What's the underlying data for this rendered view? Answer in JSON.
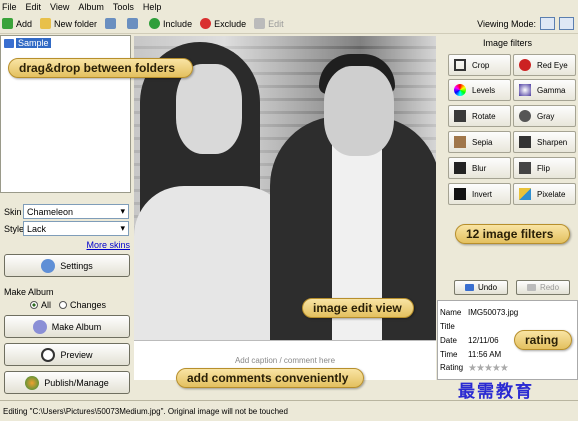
{
  "menu": [
    "File",
    "Edit",
    "View",
    "Album",
    "Tools",
    "Help"
  ],
  "toolbar": {
    "add": "Add",
    "new_folder": "New folder",
    "include": "Include",
    "exclude": "Exclude",
    "edit": "Edit",
    "viewing_mode_label": "Viewing Mode:"
  },
  "tree": {
    "item": "Sample"
  },
  "left": {
    "skin_label": "Skin",
    "skin_value": "Chameleon",
    "style_label": "Style",
    "style_value": "Lack",
    "more_skins": "More skins",
    "settings": "Settings",
    "make_album_group": "Make Album",
    "radio_all": "All",
    "radio_changes": "Changes",
    "make_album_btn": "Make Album",
    "preview": "Preview",
    "publish": "Publish/Manage"
  },
  "filters": {
    "title": "Image filters",
    "items": [
      "Crop",
      "Red Eye",
      "Levels",
      "Gamma",
      "Rotate",
      "Gray",
      "Sepia",
      "Sharpen",
      "Blur",
      "Flip",
      "Invert",
      "Pixelate"
    ],
    "undo": "Undo",
    "redo": "Redo"
  },
  "props": {
    "name_label": "Name",
    "name_value": "IMG50073.jpg",
    "title_label": "Title",
    "date_label": "Date",
    "date_value": "12/11/06",
    "time_label": "Time",
    "time_value": "11:56 AM",
    "rating_label": "Rating",
    "rating_value": 0,
    "rating_max": 5
  },
  "caption_placeholder": "Add caption / comment here",
  "status": "Editing \"C:\\Users\\Pictures\\50073Medium.jpg\". Original image will not be touched",
  "callouts": {
    "folders": "drag&drop between folders",
    "filters": "12 image filters",
    "edit_view": "image edit view",
    "comments": "add comments conveniently",
    "rating": "rating"
  },
  "watermark": "最需教育",
  "colors": {
    "accent_selected": "#316ac5",
    "callout": "#f2d37f",
    "watermark": "#2b2bd2"
  }
}
